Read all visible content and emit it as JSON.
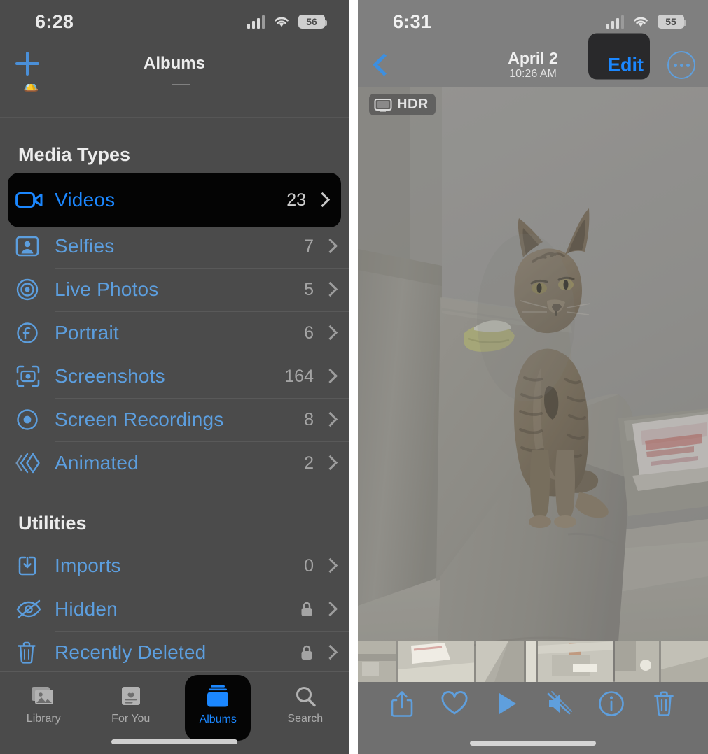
{
  "accent": "#1b87ff",
  "left_phone": {
    "status": {
      "time": "6:28",
      "battery": "56",
      "wifi_icon": "wifi-icon",
      "cellular_icon": "cellular-bars-icon"
    },
    "navbar": {
      "title": "Albums",
      "add_icon": "plus-icon"
    },
    "sections": [
      {
        "title": "Media Types",
        "rows": [
          {
            "label": "Videos",
            "count": "23",
            "icon": "video-camera-icon",
            "highlighted": true
          },
          {
            "label": "Selfies",
            "count": "7",
            "icon": "selfie-portrait-icon",
            "highlighted": false
          },
          {
            "label": "Live Photos",
            "count": "5",
            "icon": "live-photo-icon",
            "highlighted": false
          },
          {
            "label": "Portrait",
            "count": "6",
            "icon": "portrait-f-icon",
            "highlighted": false
          },
          {
            "label": "Screenshots",
            "count": "164",
            "icon": "screenshot-camera-icon",
            "highlighted": false
          },
          {
            "label": "Screen Recordings",
            "count": "8",
            "icon": "record-dot-icon",
            "highlighted": false
          },
          {
            "label": "Animated",
            "count": "2",
            "icon": "animated-gif-icon",
            "highlighted": false
          }
        ]
      },
      {
        "title": "Utilities",
        "rows": [
          {
            "label": "Imports",
            "count": "0",
            "icon": "import-tray-icon",
            "highlighted": false,
            "locked": false
          },
          {
            "label": "Hidden",
            "count": "",
            "icon": "eye-slash-icon",
            "highlighted": false,
            "locked": true
          },
          {
            "label": "Recently Deleted",
            "count": "",
            "icon": "trash-icon",
            "highlighted": false,
            "locked": true
          }
        ]
      }
    ],
    "tabbar": {
      "tabs": [
        {
          "label": "Library",
          "icon": "photo-stack-icon",
          "active": false
        },
        {
          "label": "For You",
          "icon": "for-you-card-icon",
          "active": false
        },
        {
          "label": "Albums",
          "icon": "albums-box-icon",
          "active": true
        },
        {
          "label": "Search",
          "icon": "search-icon",
          "active": false
        }
      ]
    }
  },
  "right_phone": {
    "status": {
      "time": "6:31",
      "battery": "55",
      "wifi_icon": "wifi-icon",
      "cellular_icon": "cellular-bars-icon"
    },
    "navbar": {
      "back_icon": "chevron-left-icon",
      "date": "April 2",
      "time": "10:26 AM",
      "edit_label": "Edit",
      "edit_highlighted": true,
      "more_icon": "ellipsis-circle-icon"
    },
    "photo": {
      "hdr_badge": "HDR",
      "hdr_icon": "hdr-display-icon",
      "description": "Tabby kitten sitting on the back of a light grey sofa, magazine on side table"
    },
    "toolbar": {
      "items": [
        {
          "icon": "share-icon",
          "name": "share-button"
        },
        {
          "icon": "heart-icon",
          "name": "favorite-button"
        },
        {
          "icon": "play-icon",
          "name": "play-button"
        },
        {
          "icon": "mute-icon",
          "name": "mute-button"
        },
        {
          "icon": "info-icon",
          "name": "info-button"
        },
        {
          "icon": "trash-icon",
          "name": "delete-button"
        }
      ]
    }
  }
}
